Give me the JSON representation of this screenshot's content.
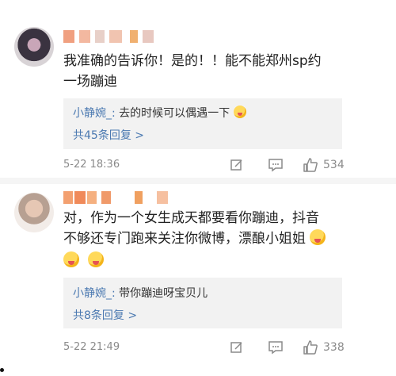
{
  "comments": [
    {
      "content_line1": "我准确的告诉你！是的！！能不能郑州sp约",
      "content_line2": "一场蹦迪",
      "reply": {
        "user": "小静婉_",
        "sep": ":",
        "text": "去的时候可以偶遇一下",
        "count_label": "共45条回复 >"
      },
      "time": "5-22 18:36",
      "likes": "534"
    },
    {
      "content_line1": "对，作为一个女生成天都要看你蹦迪，抖音",
      "content_line2": "不够还专门跑来关注你微博，漂酿小姐姐",
      "reply": {
        "user": "小静婉_",
        "sep": ":",
        "text": "带你蹦迪呀宝贝儿",
        "count_label": "共8条回复 >"
      },
      "time": "5-22 21:49",
      "likes": "338"
    }
  ],
  "icons": {
    "share": "share-edit-icon",
    "comment": "comment-icon",
    "like": "thumbs-up-icon"
  },
  "colors": {
    "link_blue": "#4b79b1",
    "meta_gray": "#8a8a8a",
    "reply_bg": "#f2f2f2"
  }
}
